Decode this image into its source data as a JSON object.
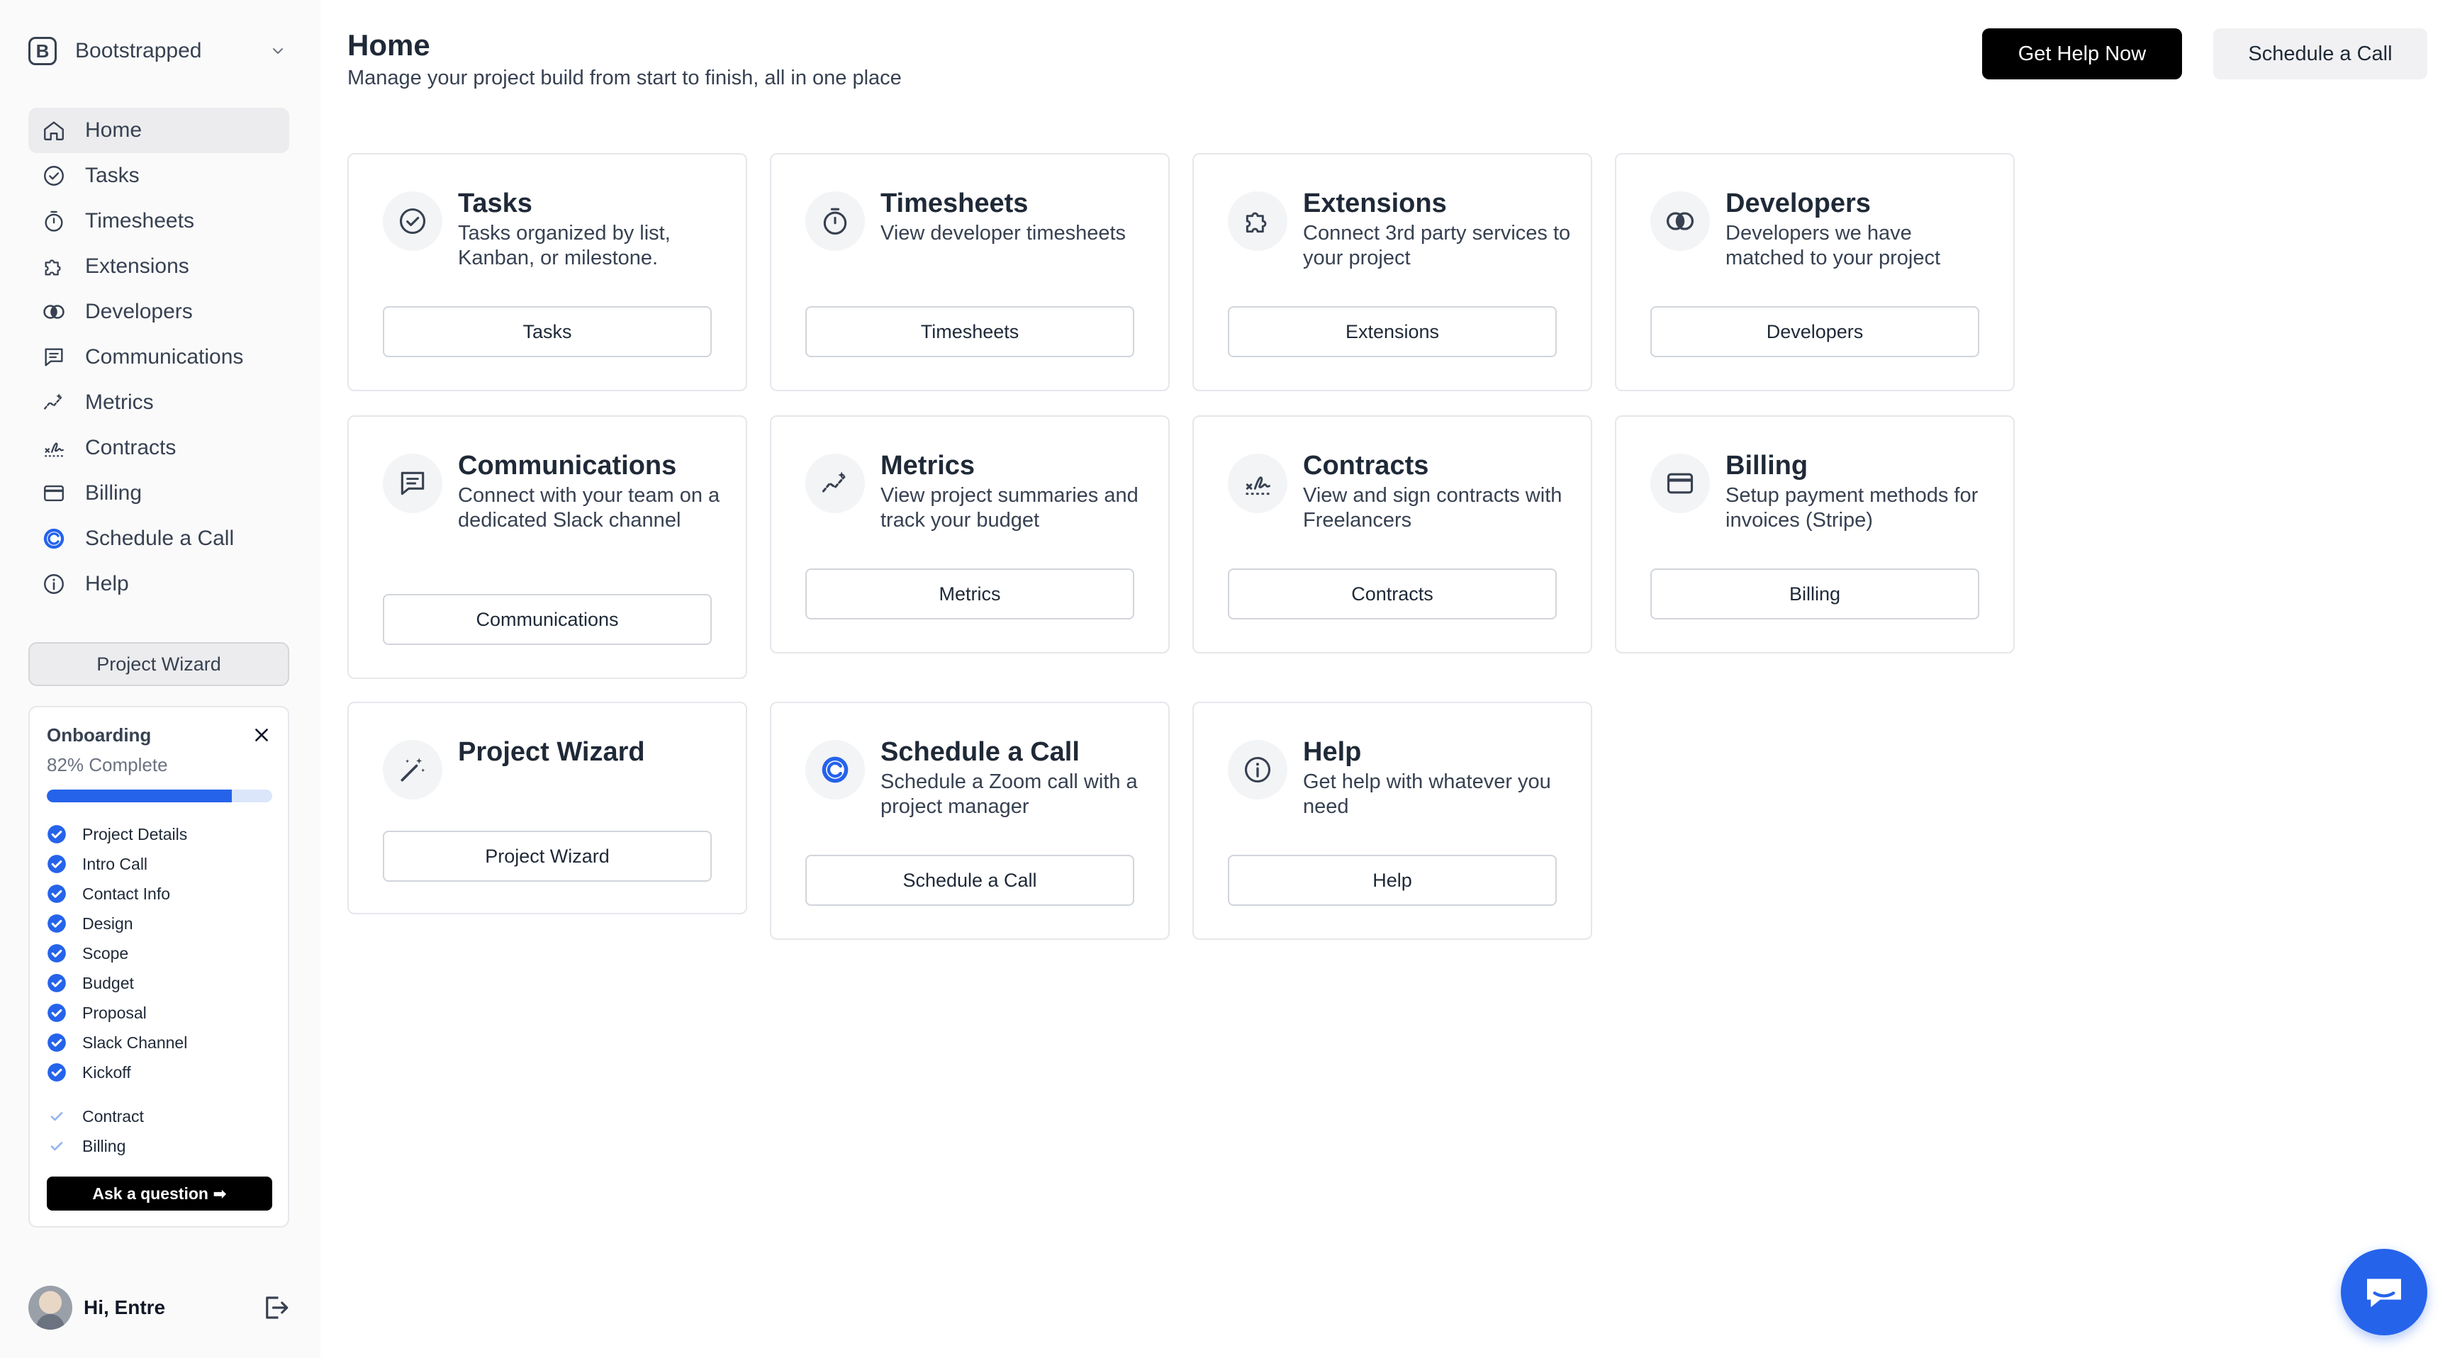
{
  "sidebar": {
    "org": {
      "initial": "B",
      "name": "Bootstrapped"
    },
    "nav": [
      {
        "label": "Home",
        "icon": "home-icon"
      },
      {
        "label": "Tasks",
        "icon": "check-circle-icon"
      },
      {
        "label": "Timesheets",
        "icon": "stopwatch-icon"
      },
      {
        "label": "Extensions",
        "icon": "puzzle-icon"
      },
      {
        "label": "Developers",
        "icon": "developers-icon"
      },
      {
        "label": "Communications",
        "icon": "chat-icon"
      },
      {
        "label": "Metrics",
        "icon": "sparkline-icon"
      },
      {
        "label": "Contracts",
        "icon": "signature-icon"
      },
      {
        "label": "Billing",
        "icon": "credit-card-icon"
      },
      {
        "label": "Schedule a Call",
        "icon": "calendly-icon"
      },
      {
        "label": "Help",
        "icon": "info-icon"
      }
    ],
    "wizard_label": "Project Wizard",
    "onboarding": {
      "title": "Onboarding",
      "percent_label": "82% Complete",
      "progress": 0.82,
      "done": [
        "Project Details",
        "Intro Call",
        "Contact Info",
        "Design",
        "Scope",
        "Budget",
        "Proposal",
        "Slack Channel",
        "Kickoff"
      ],
      "pending": [
        "Contract",
        "Billing"
      ],
      "ask_label": "Ask a question ➡"
    },
    "user": {
      "greeting": "Hi, Entre"
    }
  },
  "header": {
    "title": "Home",
    "subtitle": "Manage your project build from start to finish, all in one place",
    "primary_button": "Get Help Now",
    "secondary_button": "Schedule a Call"
  },
  "cards": [
    {
      "title": "Tasks",
      "desc": "Tasks organized by list, Kanban, or milestone.",
      "button": "Tasks",
      "icon": "check-circle-icon"
    },
    {
      "title": "Timesheets",
      "desc": "View developer timesheets",
      "button": "Timesheets",
      "icon": "stopwatch-icon"
    },
    {
      "title": "Extensions",
      "desc": "Connect 3rd party services to your project",
      "button": "Extensions",
      "icon": "puzzle-icon"
    },
    {
      "title": "Developers",
      "desc": "Developers we have matched to your project",
      "button": "Developers",
      "icon": "developers-icon"
    },
    {
      "title": "Communications",
      "desc": "Connect with your team on a dedicated Slack channel",
      "button": "Communications",
      "icon": "chat-icon"
    },
    {
      "title": "Metrics",
      "desc": "View project summaries and track your budget",
      "button": "Metrics",
      "icon": "sparkline-icon"
    },
    {
      "title": "Contracts",
      "desc": "View and sign contracts with Freelancers",
      "button": "Contracts",
      "icon": "signature-icon"
    },
    {
      "title": "Billing",
      "desc": "Setup payment methods for invoices (Stripe)",
      "button": "Billing",
      "icon": "credit-card-icon"
    },
    {
      "title": "Project Wizard",
      "desc": "",
      "button": "Project Wizard",
      "icon": "magic-wand-icon"
    },
    {
      "title": "Schedule a Call",
      "desc": "Schedule a Zoom call with a project manager",
      "button": "Schedule a Call",
      "icon": "calendly-icon"
    },
    {
      "title": "Help",
      "desc": "Get help with whatever you need",
      "button": "Help",
      "icon": "info-icon"
    }
  ],
  "colors": {
    "accent": "#2563eb",
    "primary_button": "#000000"
  }
}
